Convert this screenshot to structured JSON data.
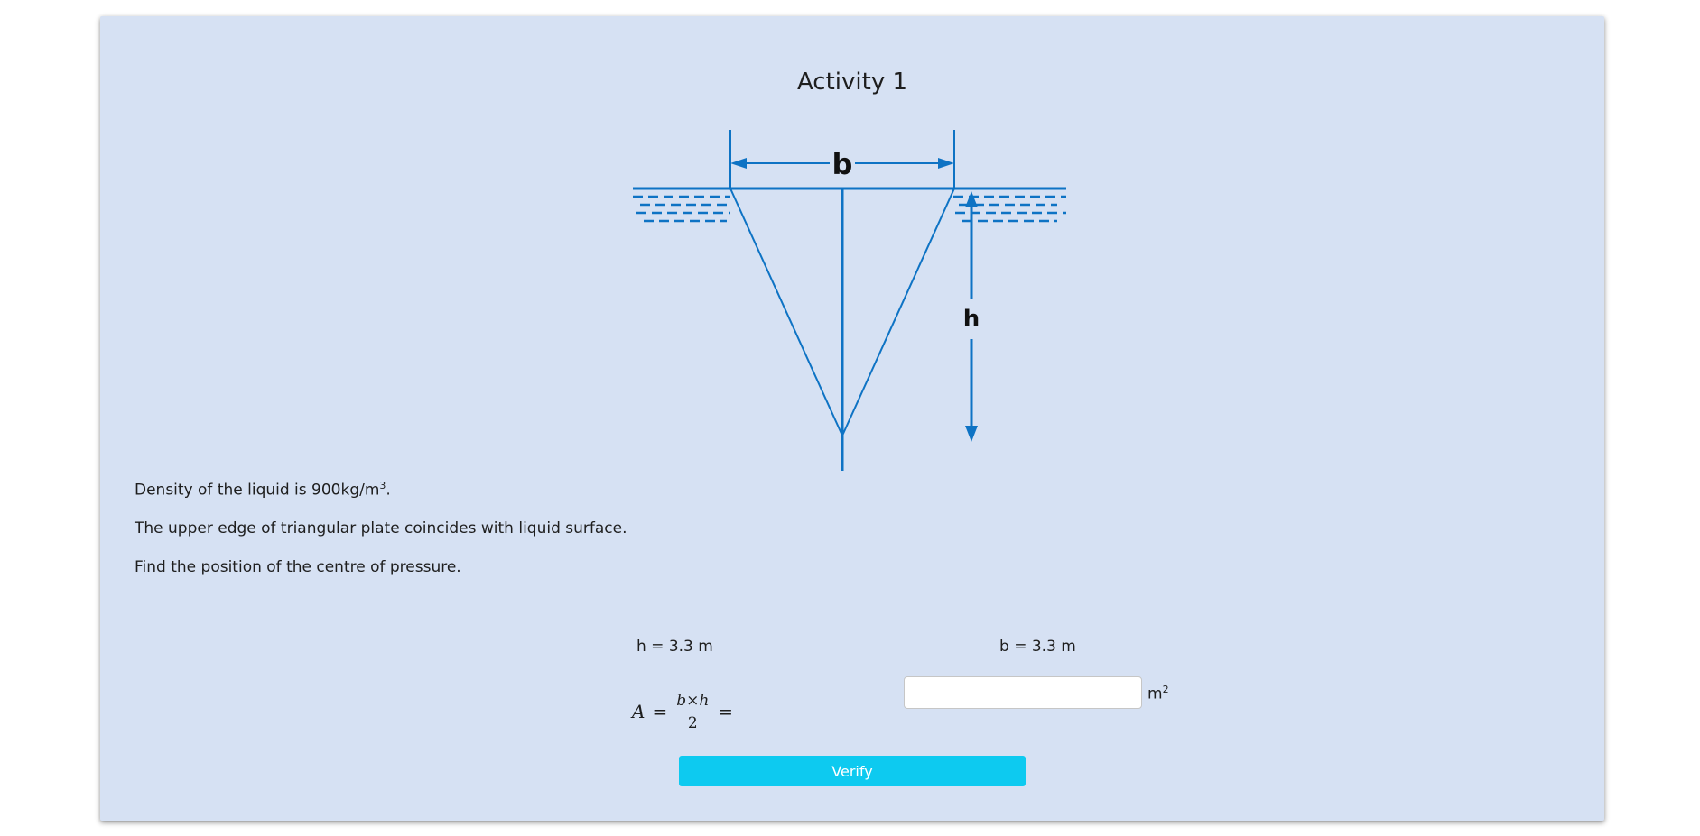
{
  "activity": {
    "title": "Activity 1"
  },
  "diagram": {
    "label_b": "b",
    "label_h": "h"
  },
  "problem": {
    "density_prefix": "Density of the liquid is 900kg/m",
    "density_exp": "3",
    "density_suffix": ".",
    "line2": "The upper edge of triangular plate coincides with liquid surface.",
    "line3": "Find the position of the centre of pressure."
  },
  "given": {
    "h": "h = 3.3 m",
    "b": "b = 3.3 m"
  },
  "formula": {
    "lhs": "A",
    "eq": "=",
    "numerator": "b×h",
    "denominator": "2"
  },
  "answer": {
    "value": "",
    "placeholder": "",
    "unit": "m",
    "unit_exp": "2"
  },
  "actions": {
    "verify_label": "Verify"
  },
  "colors": {
    "card_bg": "#d6e1f3",
    "diagram_blue": "#0e73c4",
    "button_bg": "#0dcaf0"
  }
}
